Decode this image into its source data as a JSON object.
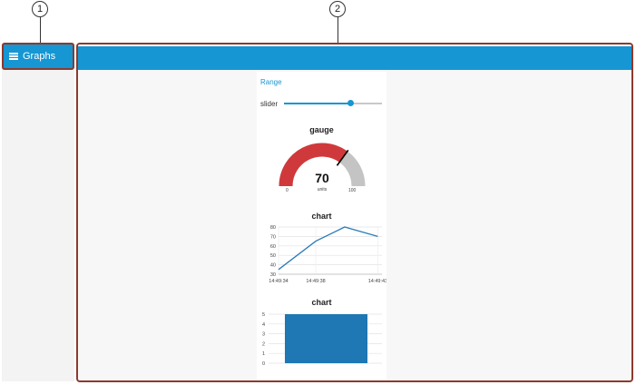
{
  "callouts": [
    "1",
    "2"
  ],
  "nav": {
    "menu_icon": "hamburger-menu-icon",
    "title": "Graphs"
  },
  "range_group": {
    "label": "Range"
  },
  "slider": {
    "label": "slider",
    "value_fraction": 0.68
  },
  "gauge": {
    "title": "gauge",
    "value": "70",
    "units": "units",
    "min": "0",
    "max": "100",
    "value_fraction": 0.7,
    "fill_color": "#d0393b",
    "track_color": "#c4c4c4"
  },
  "chart_data": [
    {
      "type": "line",
      "title": "chart",
      "x_ticks": [
        "14:49:34",
        "14:49:38",
        "14:49:43"
      ],
      "y_ticks": [
        "30",
        "40",
        "50",
        "60",
        "70",
        "80"
      ],
      "ylim": [
        30,
        80
      ],
      "grid": true,
      "series": [
        {
          "color": "#2b7bb9",
          "points": [
            [
              0,
              35
            ],
            [
              4.5,
              65
            ],
            [
              8,
              80
            ],
            [
              12,
              70
            ]
          ]
        }
      ],
      "xlim": [
        0,
        12.5
      ]
    },
    {
      "type": "bar",
      "title": "chart",
      "y_ticks": [
        "0",
        "1",
        "2",
        "3",
        "4",
        "5"
      ],
      "ylim": [
        0,
        5
      ],
      "grid": true,
      "values": [
        5
      ],
      "color": "#1f77b4"
    }
  ],
  "colors": {
    "accent": "#1696d2",
    "frame": "#8b3a2e"
  }
}
